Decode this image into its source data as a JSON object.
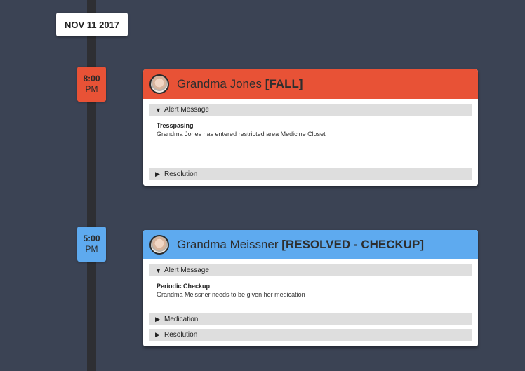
{
  "timeline": {
    "date": "NOV 11 2017",
    "events": [
      {
        "time": "8:00",
        "period": "PM",
        "resident": "Grandma Jones",
        "status": "[FALL]",
        "alert_label": "Alert Message",
        "alert_title": "Tresspasing",
        "alert_text": "Grandma Jones has entered restricted area Medicine Closet",
        "resolution_label": "Resolution"
      },
      {
        "time": "5:00",
        "period": "PM",
        "resident": "Grandma Meissner",
        "status": "[RESOLVED - CHECKUP]",
        "alert_label": "Alert Message",
        "alert_title": "Periodic Checkup",
        "alert_text": "Grandma Meissner needs to be given her medication",
        "medication_label": "Medication",
        "resolution_label": "Resolution"
      }
    ]
  },
  "icons": {
    "expanded": "▼",
    "collapsed": "▶"
  },
  "colors": {
    "background": "#3b4354",
    "alert_red": "#e85236",
    "resolved_blue": "#5eaaef"
  }
}
